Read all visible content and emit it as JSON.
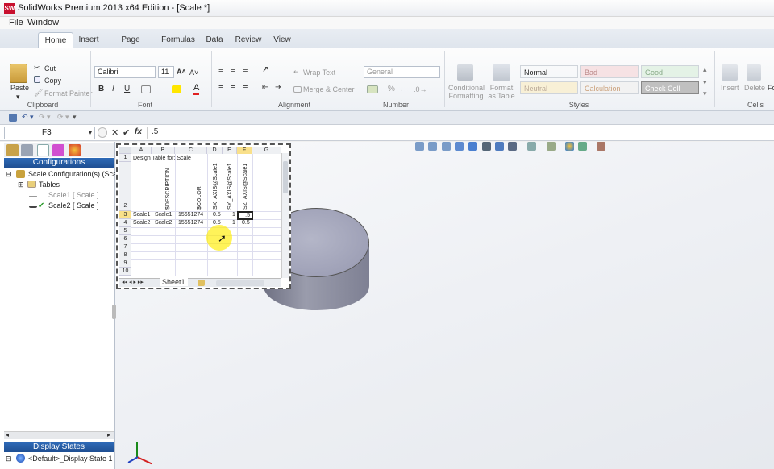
{
  "window": {
    "title": "SolidWorks Premium 2013 x64 Edition - [Scale *]",
    "app_icon": "SW"
  },
  "menu": [
    "File",
    "Window"
  ],
  "ribbon_tabs": [
    "Home",
    "Insert",
    "Page Layout",
    "Formulas",
    "Data",
    "Review",
    "View"
  ],
  "clipboard": {
    "paste": "Paste",
    "cut": "Cut",
    "copy": "Copy",
    "format_painter": "Format Painter",
    "group": "Clipboard"
  },
  "font": {
    "name": "Calibri",
    "size": "11",
    "bold": "B",
    "italic": "I",
    "underline": "U",
    "grow": "A˄",
    "shrink": "A˅",
    "color_btn": "A",
    "group": "Font"
  },
  "alignment": {
    "wrap": "Wrap Text",
    "merge": "Merge & Center",
    "group": "Alignment"
  },
  "number": {
    "format": "General",
    "percent": "%",
    "comma": ",",
    "group": "Number"
  },
  "styles": {
    "conditional": "Conditional Formatting",
    "format_table": "Format as Table",
    "cells": [
      {
        "label": "Normal",
        "bg": "#ffffff",
        "fg": "#222222"
      },
      {
        "label": "Bad",
        "bg": "#ffc7ce",
        "fg": "#9c0006"
      },
      {
        "label": "Good",
        "bg": "#c6efce",
        "fg": "#006100"
      },
      {
        "label": "Neutral",
        "bg": "#ffeb9c",
        "fg": "#9c6500"
      },
      {
        "label": "Calculation",
        "bg": "#f2f2f2",
        "fg": "#fa7d00"
      },
      {
        "label": "Check Cell",
        "bg": "#a5a5a5",
        "fg": "#ffffff"
      }
    ],
    "group": "Styles"
  },
  "cells_group": {
    "insert": "Insert",
    "delete": "Delete",
    "format_partial": "Fo",
    "group": "Cells"
  },
  "formula_bar": {
    "name_box": "F3",
    "value": ".5",
    "fx": "fx",
    "cancel": "✕",
    "enter": "✔"
  },
  "feature_manager": {
    "header": "Configurations",
    "tree": [
      {
        "label": "Scale Configuration(s)  (Scale)",
        "level": 0
      },
      {
        "label": "Tables",
        "level": 1
      },
      {
        "label": "Scale1 [ Scale ]",
        "level": 2,
        "dim": true
      },
      {
        "label": "Scale2 [ Scale ]",
        "level": 2,
        "dim": false
      }
    ],
    "bottom_header": "Display States",
    "display_state": "<Default>_Display State 1"
  },
  "sheet": {
    "columns": [
      "A",
      "B",
      "C",
      "D",
      "E",
      "F",
      "G"
    ],
    "rows": [
      "1",
      "2",
      "3",
      "4",
      "5",
      "6",
      "7",
      "8",
      "9",
      "10"
    ],
    "title": "Design Table for: Scale",
    "headers": [
      "$DESCRIPTION",
      "$COLOR",
      "SX_AXIS@Scale1",
      "SY_AXIS@Scale1",
      "SZ_AXIS@Scale1"
    ],
    "data": [
      {
        "a": "Scale1",
        "b": "Scale1",
        "c": "15651274",
        "d": "0.5",
        "e": "1",
        "f": ".5"
      },
      {
        "a": "Scale2",
        "b": "Scale2",
        "c": "15651274",
        "d": "0.5",
        "e": "1",
        "f": "0.5"
      }
    ],
    "tab": "Sheet1"
  },
  "colors": {
    "config_header": "#2456a4",
    "selected_col": "#f9e08a",
    "part": "#9ea0b5"
  }
}
